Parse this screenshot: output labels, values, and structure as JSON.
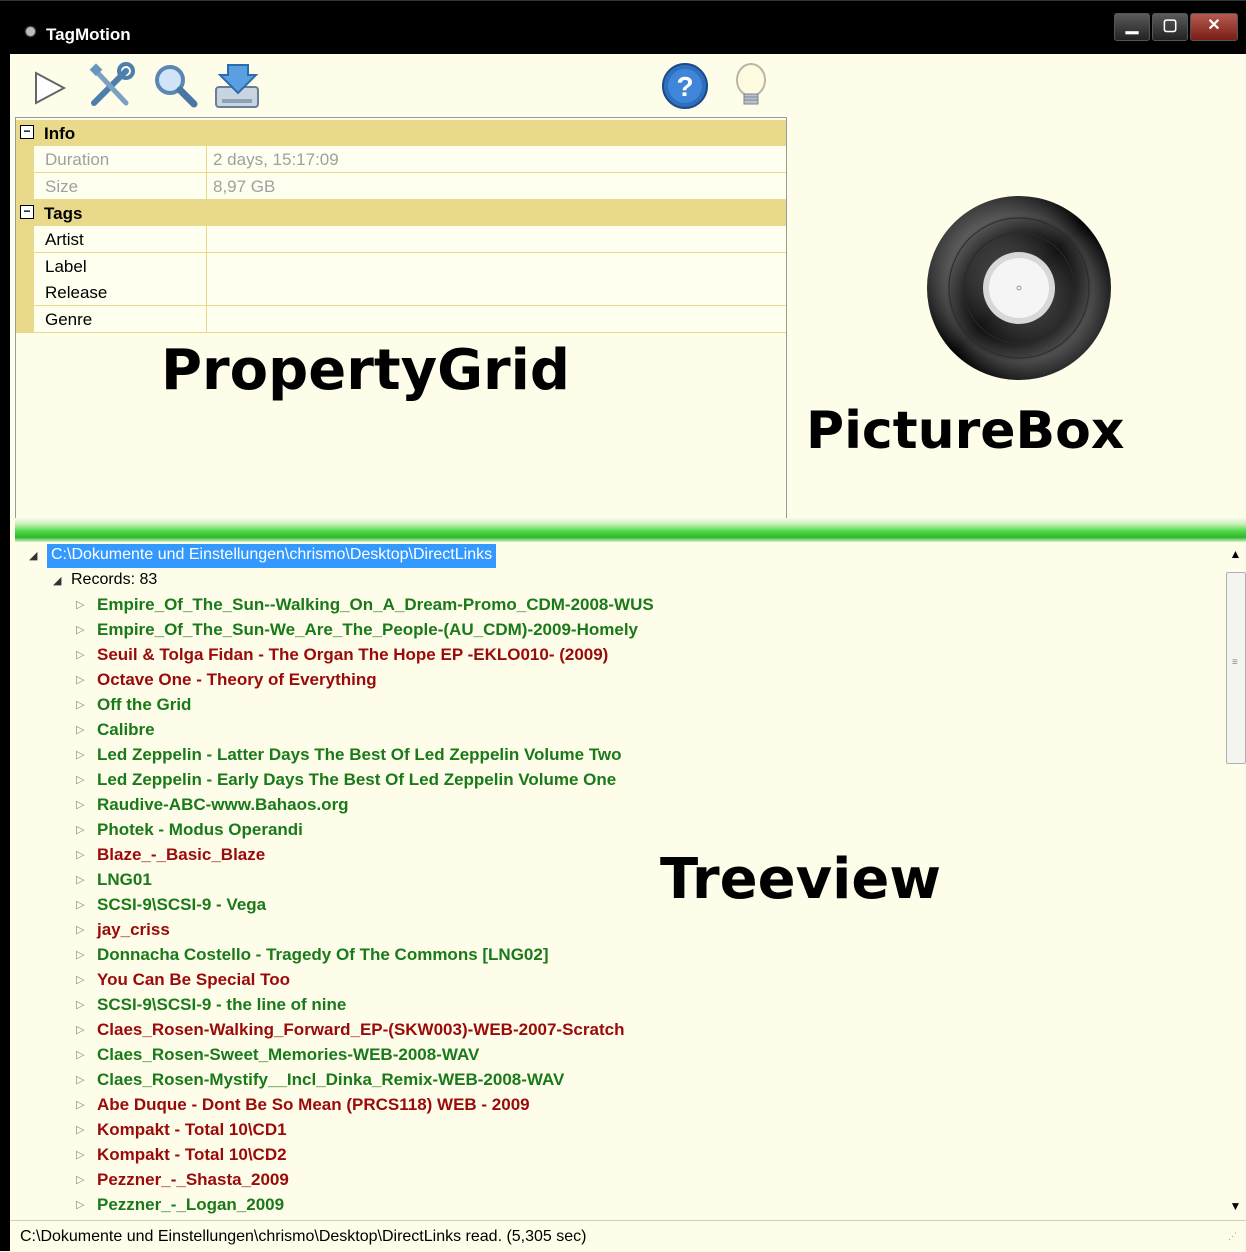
{
  "window": {
    "title": "TagMotion"
  },
  "toolbar": {
    "icons": [
      "play-icon",
      "tools-icon",
      "search-icon",
      "import-icon",
      "help-icon",
      "lightbulb-icon"
    ]
  },
  "property_grid": {
    "categories": [
      {
        "label": "Info",
        "toggle": "⊟",
        "props": [
          {
            "name": "Duration",
            "value": "2 days, 15:17:09"
          },
          {
            "name": "Size",
            "value": "8,97 GB"
          }
        ]
      },
      {
        "label": "Tags",
        "toggle": "⊟",
        "props": [
          {
            "name": "Artist",
            "value": ""
          },
          {
            "name": "Label",
            "value": ""
          },
          {
            "name": "Release",
            "value": ""
          },
          {
            "name": "Genre",
            "value": ""
          }
        ]
      }
    ],
    "overlay_label": "PropertyGrid"
  },
  "picture_box": {
    "overlay_label": "PictureBox"
  },
  "tree": {
    "overlay_label": "Treeview",
    "root": "C:\\Dokumente und Einstellungen\\chrismo\\Desktop\\DirectLinks",
    "records": "Records: 83",
    "colors": {
      "green": "#1a7a1a",
      "red": "#9b0a0a"
    },
    "items": [
      {
        "text": "Empire_Of_The_Sun--Walking_On_A_Dream-Promo_CDM-2008-WUS",
        "color": "green"
      },
      {
        "text": "Empire_Of_The_Sun-We_Are_The_People-(AU_CDM)-2009-Homely",
        "color": "green"
      },
      {
        "text": "Seuil & Tolga Fidan - The Organ The Hope EP -EKLO010- (2009)",
        "color": "red"
      },
      {
        "text": "Octave One - Theory of Everything",
        "color": "red"
      },
      {
        "text": "Off the Grid",
        "color": "green"
      },
      {
        "text": "Calibre",
        "color": "green"
      },
      {
        "text": "Led Zeppelin - Latter Days The Best Of Led Zeppelin Volume Two",
        "color": "green"
      },
      {
        "text": "Led Zeppelin - Early Days The Best Of Led Zeppelin Volume One",
        "color": "green"
      },
      {
        "text": "Raudive-ABC-www.Bahaos.org",
        "color": "green"
      },
      {
        "text": "Photek - Modus Operandi",
        "color": "green"
      },
      {
        "text": "Blaze_-_Basic_Blaze",
        "color": "red"
      },
      {
        "text": "LNG01",
        "color": "green"
      },
      {
        "text": "SCSI-9\\SCSI-9 - Vega",
        "color": "green"
      },
      {
        "text": "jay_criss",
        "color": "red"
      },
      {
        "text": "Donnacha Costello - Tragedy Of The Commons [LNG02]",
        "color": "green"
      },
      {
        "text": "You Can Be Special Too",
        "color": "red"
      },
      {
        "text": "SCSI-9\\SCSI-9 - the line of nine",
        "color": "green"
      },
      {
        "text": "Claes_Rosen-Walking_Forward_EP-(SKW003)-WEB-2007-Scratch",
        "color": "red"
      },
      {
        "text": "Claes_Rosen-Sweet_Memories-WEB-2008-WAV",
        "color": "green"
      },
      {
        "text": "Claes_Rosen-Mystify__Incl_Dinka_Remix-WEB-2008-WAV",
        "color": "green"
      },
      {
        "text": "Abe Duque - Dont Be So Mean (PRCS118) WEB - 2009",
        "color": "red"
      },
      {
        "text": "Kompakt - Total 10\\CD1",
        "color": "red"
      },
      {
        "text": "Kompakt - Total 10\\CD2",
        "color": "red"
      },
      {
        "text": "Pezzner_-_Shasta_2009",
        "color": "red"
      },
      {
        "text": "Pezzner_-_Logan_2009",
        "color": "green"
      }
    ]
  },
  "status": {
    "text": "C:\\Dokumente und Einstellungen\\chrismo\\Desktop\\DirectLinks read. (5,305 sec)"
  }
}
